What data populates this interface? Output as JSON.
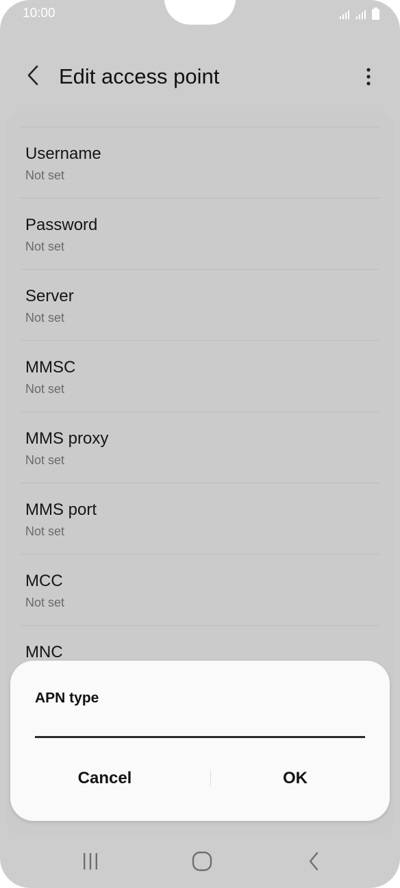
{
  "status_bar": {
    "time": "10:00"
  },
  "app_bar": {
    "title": "Edit access point"
  },
  "settings": [
    {
      "title": "Username",
      "value": "Not set"
    },
    {
      "title": "Password",
      "value": "Not set"
    },
    {
      "title": "Server",
      "value": "Not set"
    },
    {
      "title": "MMSC",
      "value": "Not set"
    },
    {
      "title": "MMS proxy",
      "value": "Not set"
    },
    {
      "title": "MMS port",
      "value": "Not set"
    },
    {
      "title": "MCC",
      "value": "Not set"
    },
    {
      "title": "MNC",
      "value": ""
    }
  ],
  "dialog": {
    "title": "APN type",
    "input_value": "",
    "cancel_label": "Cancel",
    "ok_label": "OK"
  },
  "icons": {
    "back": "back-arrow-icon",
    "more": "more-options-icon",
    "signal": "signal-icon",
    "battery": "battery-icon",
    "recents": "recents-icon",
    "home": "home-icon",
    "nav_back": "nav-back-icon"
  },
  "colors": {
    "background": "#cdcdcd",
    "dialog": "#fafafa",
    "text_primary": "#151515",
    "text_secondary": "#6a6a6a"
  }
}
